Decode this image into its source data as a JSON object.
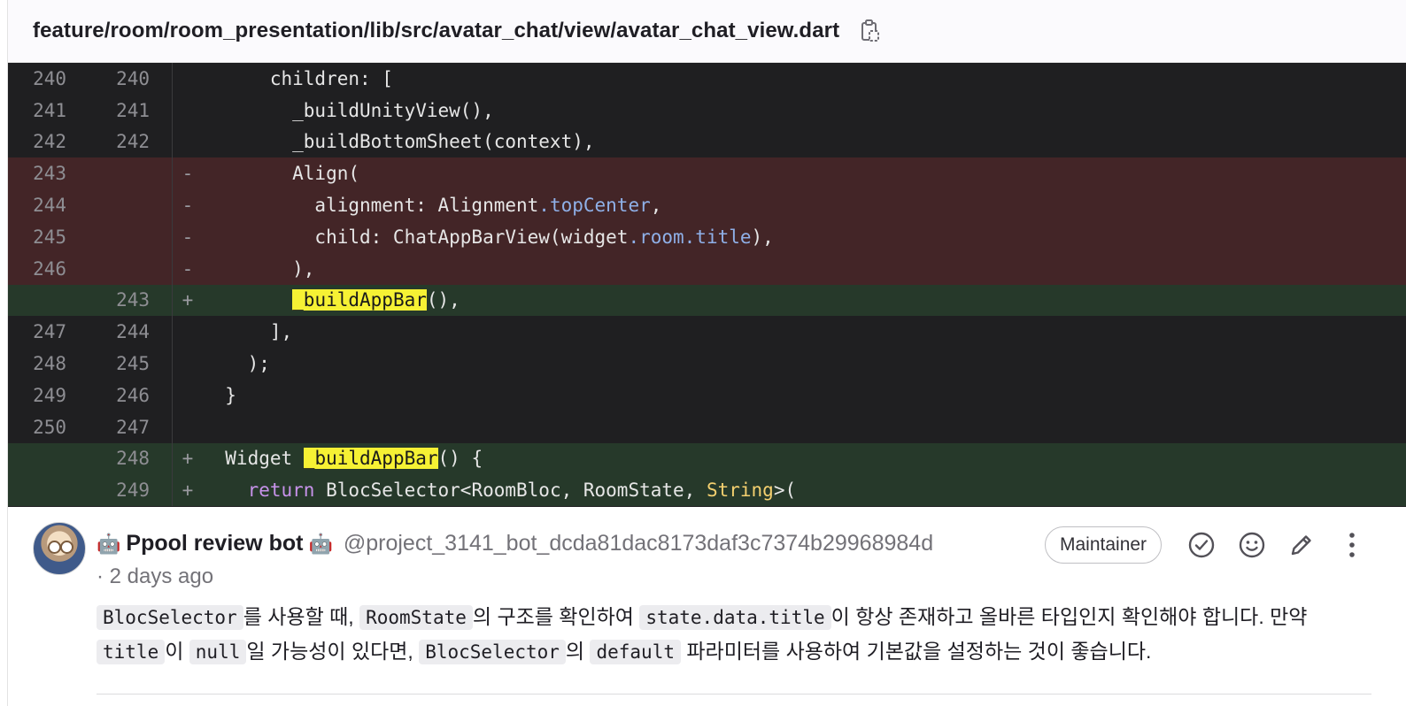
{
  "file": {
    "path": "feature/room/room_presentation/lib/src/avatar_chat/view/avatar_chat_view.dart",
    "copy_icon": "clipboard-copy-icon"
  },
  "diff": {
    "highlight_term": "_buildAppBar",
    "lines": [
      {
        "old": "240",
        "new": "240",
        "sign": "",
        "type": "ctx",
        "code": "      children: ["
      },
      {
        "old": "241",
        "new": "241",
        "sign": "",
        "type": "ctx",
        "code": "        _buildUnityView(),"
      },
      {
        "old": "242",
        "new": "242",
        "sign": "",
        "type": "ctx",
        "code": "        _buildBottomSheet(context),"
      },
      {
        "old": "243",
        "new": "",
        "sign": "-",
        "type": "del",
        "code": "        Align("
      },
      {
        "old": "244",
        "new": "",
        "sign": "-",
        "type": "del",
        "code": "          alignment: Alignment.topCenter,"
      },
      {
        "old": "245",
        "new": "",
        "sign": "-",
        "type": "del",
        "code": "          child: ChatAppBarView(widget.room.title),"
      },
      {
        "old": "246",
        "new": "",
        "sign": "-",
        "type": "del",
        "code": "        ),"
      },
      {
        "old": "",
        "new": "243",
        "sign": "+",
        "type": "add",
        "code": "        _buildAppBar(),"
      },
      {
        "old": "247",
        "new": "244",
        "sign": "",
        "type": "ctx",
        "code": "      ],"
      },
      {
        "old": "248",
        "new": "245",
        "sign": "",
        "type": "ctx",
        "code": "    );"
      },
      {
        "old": "249",
        "new": "246",
        "sign": "",
        "type": "ctx",
        "code": "  }"
      },
      {
        "old": "250",
        "new": "247",
        "sign": "",
        "type": "ctx",
        "code": ""
      },
      {
        "old": "",
        "new": "248",
        "sign": "+",
        "type": "add",
        "code": "  Widget _buildAppBar() {"
      },
      {
        "old": "",
        "new": "249",
        "sign": "+",
        "type": "add",
        "code": "    return BlocSelector<RoomBloc, RoomState, String>("
      }
    ]
  },
  "comment": {
    "bot_emoji": "🤖",
    "author": "Ppool review bot",
    "handle": "@project_3141_bot_dcda81dac8173daf3c7374b29968984d",
    "time": "· 2 days ago",
    "role_badge": "Maintainer",
    "actions": {
      "resolve_icon": "check-circle-icon",
      "emoji_icon": "smiley-icon",
      "edit_icon": "pencil-icon",
      "more_icon": "kebab-menu-icon"
    },
    "body": {
      "c1": "BlocSelector",
      "t1": "를 사용할 때, ",
      "c2": "RoomState",
      "t2": "의 구조를 확인하여 ",
      "c3": "state.data.title",
      "t3": "이 항상 존재하고 올바른 타입인지 확인해야 합니다. 만약 ",
      "c4": "title",
      "t4": "이 ",
      "c5": "null",
      "t5": "일 가능성이 있다면, ",
      "c6": "BlocSelector",
      "t6": "의 ",
      "c7": "default",
      "t7": " 파라미터를 사용하여 기본값을 설정하는 것이 좋습니다."
    }
  },
  "colors": {
    "diff_bg": "#1f1f21",
    "deleted_bg": "#432527",
    "added_bg": "#26392a",
    "highlight": "#f6f134"
  }
}
